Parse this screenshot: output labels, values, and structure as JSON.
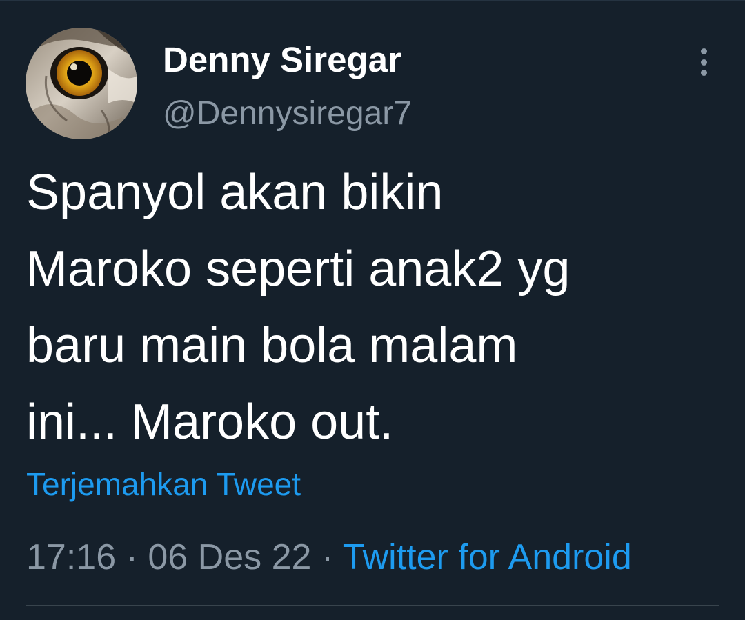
{
  "tweet": {
    "author": {
      "display_name": "Denny Siregar",
      "handle": "@Dennysiregar7",
      "avatar_icon": "owl-eye-avatar"
    },
    "more_icon": "more-vertical-icon",
    "text_lines": [
      "Spanyol akan bikin",
      "Maroko seperti anak2 yg",
      "baru main bola malam",
      "ini... Maroko out."
    ],
    "translate_label": "Terjemahkan Tweet",
    "time": "17:16",
    "separator": " · ",
    "date": "06 Des 22",
    "source": "Twitter for Android"
  },
  "colors": {
    "background": "#15202b",
    "primary_text": "#ffffff",
    "secondary_text": "#8b98a5",
    "accent": "#1d9bf0",
    "divider": "#38444d"
  }
}
